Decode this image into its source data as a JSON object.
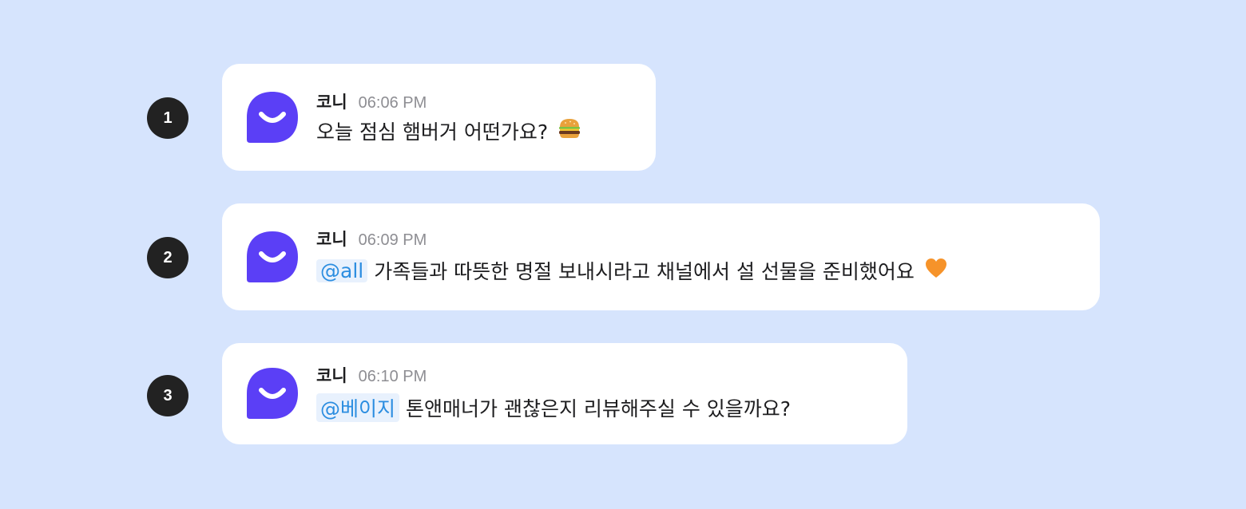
{
  "messages": [
    {
      "step": "1",
      "sender": "코니",
      "time": "06:06 PM",
      "mention": "",
      "text": "오늘 점심 햄버거 어떤가요?",
      "emoji_icon": "hamburger-icon"
    },
    {
      "step": "2",
      "sender": "코니",
      "time": "06:09 PM",
      "mention": "@all",
      "text": "가족들과 따뜻한 명절 보내시라고 채널에서 설 선물을 준비했어요",
      "emoji_icon": "orange-heart-icon"
    },
    {
      "step": "3",
      "sender": "코니",
      "time": "06:10 PM",
      "mention": "@베이지",
      "text": "톤앤매너가 괜찮은지 리뷰해주실 수 있을까요?",
      "emoji_icon": ""
    }
  ],
  "colors": {
    "background": "#d6e4fd",
    "bubble": "#ffffff",
    "avatar": "#5b3ff6",
    "step_badge": "#222222",
    "mention_bg": "#e8f1fd",
    "mention_text": "#2b8de0",
    "time_text": "#8e8e93"
  }
}
